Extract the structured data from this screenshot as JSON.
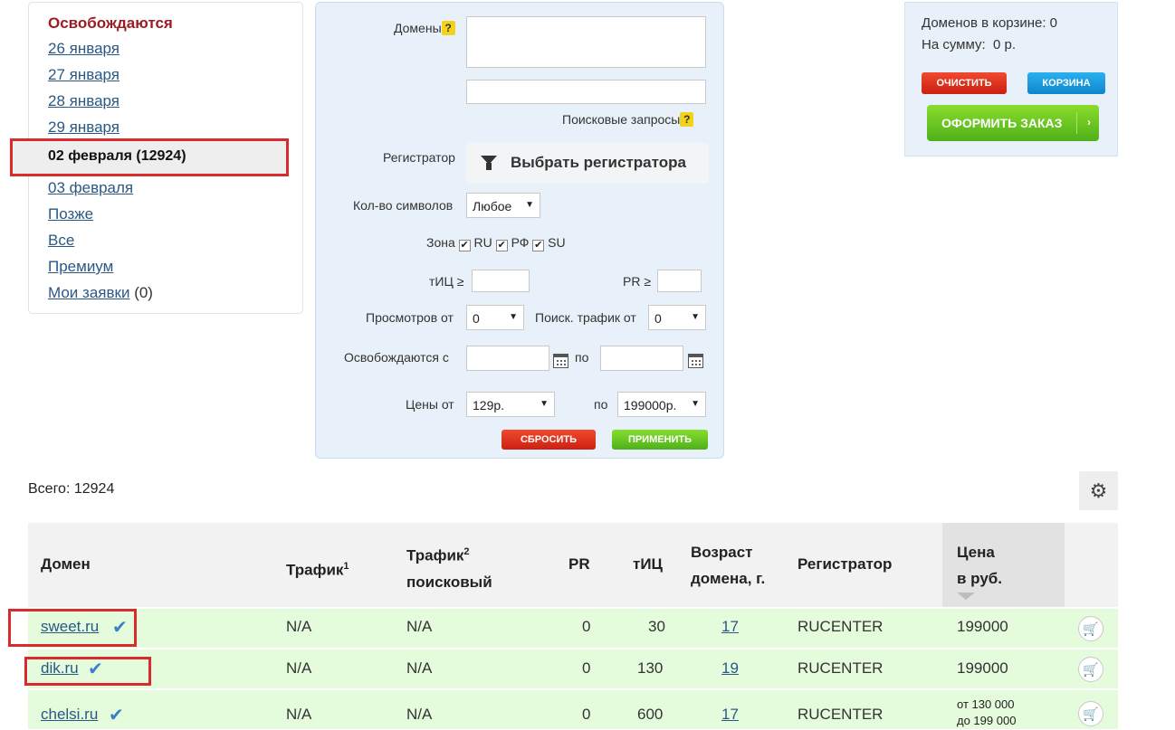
{
  "dates": {
    "title": "Освобождаются",
    "items": [
      "26 января",
      "27 января",
      "28 января",
      "29 января"
    ],
    "active": "02 февраля (12924)",
    "after": [
      "03 февраля",
      "Позже",
      "Все",
      "Премиум"
    ],
    "my_requests_label": "Мои заявки",
    "my_requests_count": "(0)"
  },
  "filter": {
    "domains_label": "Домены",
    "help_glyph": "?",
    "search_queries_label": "Поисковые запросы",
    "registrar_label": "Регистратор",
    "registrar_button": "Выбрать регистратора",
    "chars_label": "Кол-во символов",
    "chars_value": "Любое",
    "zone_label": "Зона",
    "zones": [
      "RU",
      "РФ",
      "SU"
    ],
    "tic_label": "тИЦ ≥",
    "pr_label": "PR ≥",
    "views_label": "Просмотров от",
    "views_value": "0",
    "traffic_label": "Поиск. трафик от",
    "traffic_value": "0",
    "release_label": "Освобождаются с",
    "to_label": "по",
    "price_label": "Цены от",
    "price_from": "129р.",
    "price_to_label": "по",
    "price_to": "199000р.",
    "reset_button": "СБРОСИТЬ",
    "apply_button": "ПРИМЕНИТЬ"
  },
  "cart": {
    "count_line": "Доменов в корзине: 0",
    "sum_line": "На сумму:  0 р.",
    "clear_button": "ОЧИСТИТЬ",
    "cart_button": "КОРЗИНА",
    "order_button": "ОФОРМИТЬ ЗАКАЗ"
  },
  "results": {
    "total": "Всего: 12924",
    "columns": {
      "domain": "Домен",
      "traffic": "Трафик",
      "traffic_sup": "1",
      "search_traffic_1": "Трафик",
      "search_traffic_sup": "2",
      "search_traffic_2": "поисковый",
      "pr": "PR",
      "tic": "тИЦ",
      "age_1": "Возраст",
      "age_2": "домена, г.",
      "registrar": "Регистратор",
      "price_1": "Цена",
      "price_2": "в руб."
    },
    "rows": [
      {
        "domain": "sweet.ru",
        "traffic": "N/A",
        "search": "N/A",
        "pr": "0",
        "tic": "30",
        "age": "17",
        "registrar": "RUCENTER",
        "price": "199000"
      },
      {
        "domain": "dik.ru",
        "traffic": "N/A",
        "search": "N/A",
        "pr": "0",
        "tic": "130",
        "age": "19",
        "registrar": "RUCENTER",
        "price": "199000"
      },
      {
        "domain": "chelsi.ru",
        "traffic": "N/A",
        "search": "N/A",
        "pr": "0",
        "tic": "600",
        "age": "17",
        "registrar": "RUCENTER",
        "price_from": "от 130 000",
        "price_to": "до 199 000"
      }
    ]
  }
}
